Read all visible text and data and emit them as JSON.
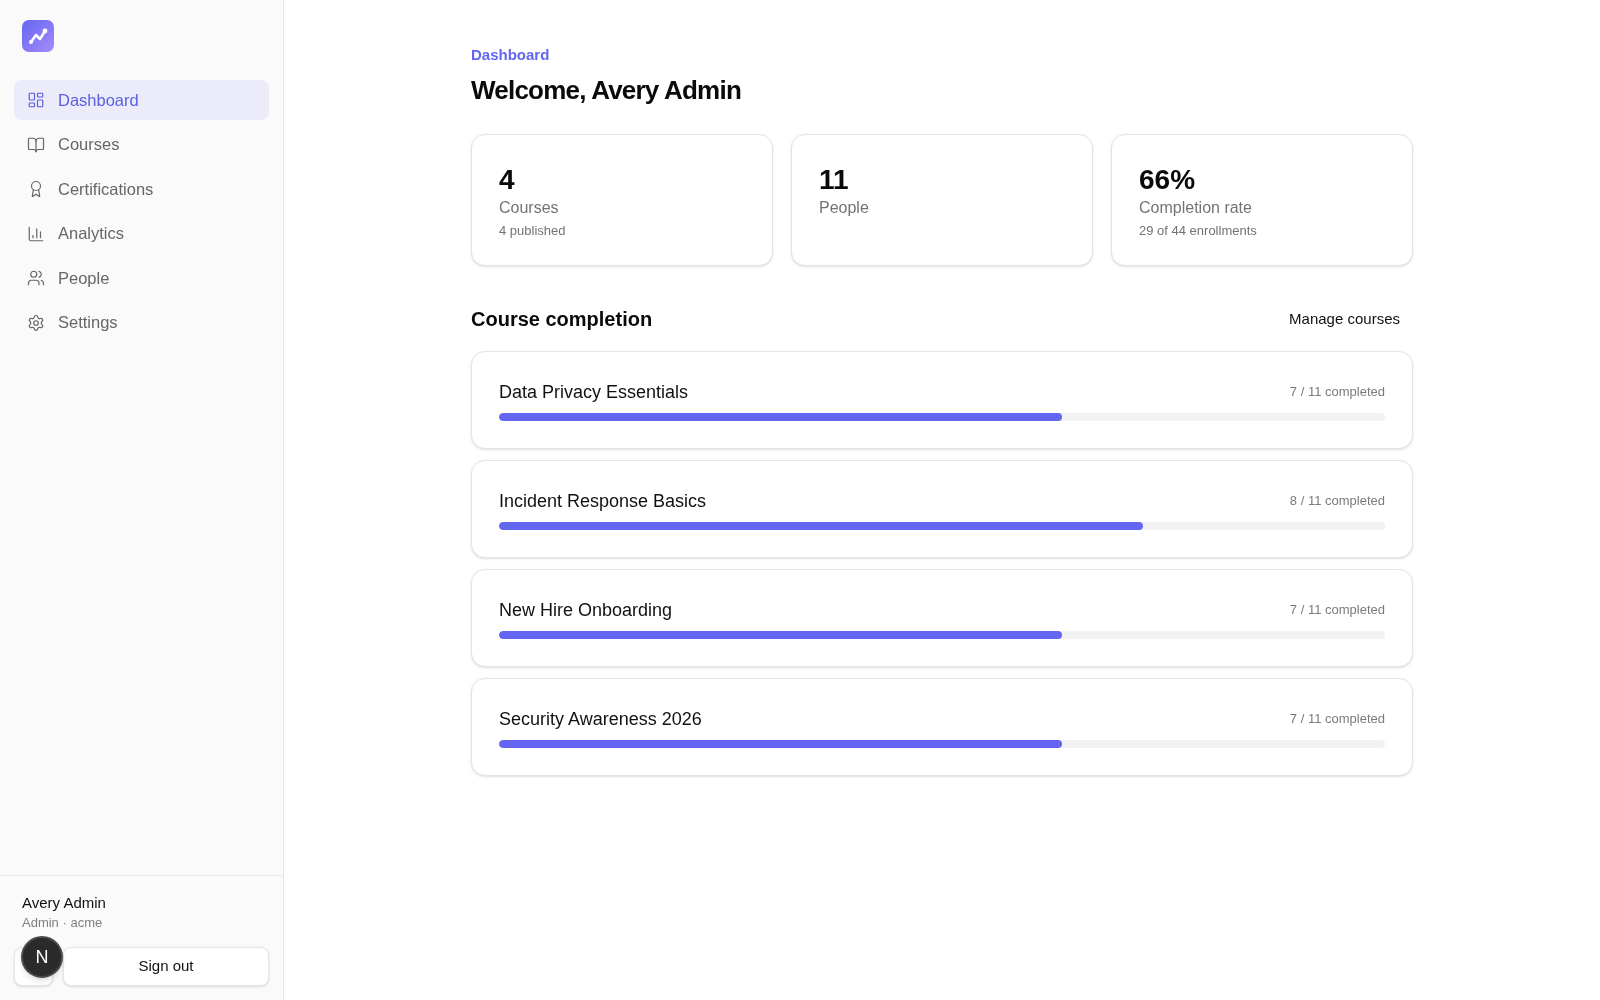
{
  "sidebar": {
    "nav_items": [
      {
        "label": "Dashboard",
        "selected": true
      },
      {
        "label": "Courses",
        "selected": false
      },
      {
        "label": "Certifications",
        "selected": false
      },
      {
        "label": "Analytics",
        "selected": false
      },
      {
        "label": "People",
        "selected": false
      },
      {
        "label": "Settings",
        "selected": false
      }
    ],
    "user": {
      "name": "Avery Admin",
      "role": "Admin · acme"
    },
    "sign_out_button": "Sign out"
  },
  "floating_badge": {
    "label": "N"
  },
  "main": {
    "breadcrumb": "Dashboard",
    "heading": "Welcome, Avery Admin",
    "stats": [
      {
        "value": "4",
        "label": "Courses",
        "note": "4 published"
      },
      {
        "value": "11",
        "label": "People"
      },
      {
        "value": "66%",
        "label": "Completion rate",
        "note": "29 of 44 enrollments"
      }
    ],
    "section": {
      "title": "Course completion",
      "action_button": "Manage courses"
    },
    "courses": [
      {
        "name": "Data Privacy Essentials",
        "reading": "7 / 11 completed",
        "level": 0.636
      },
      {
        "name": "Incident Response Basics",
        "reading": "8 / 11 completed",
        "level": 0.727
      },
      {
        "name": "New Hire Onboarding",
        "reading": "7 / 11 completed",
        "level": 0.636
      },
      {
        "name": "Security Awareness 2026",
        "reading": "7 / 11 completed",
        "level": 0.636
      }
    ]
  }
}
